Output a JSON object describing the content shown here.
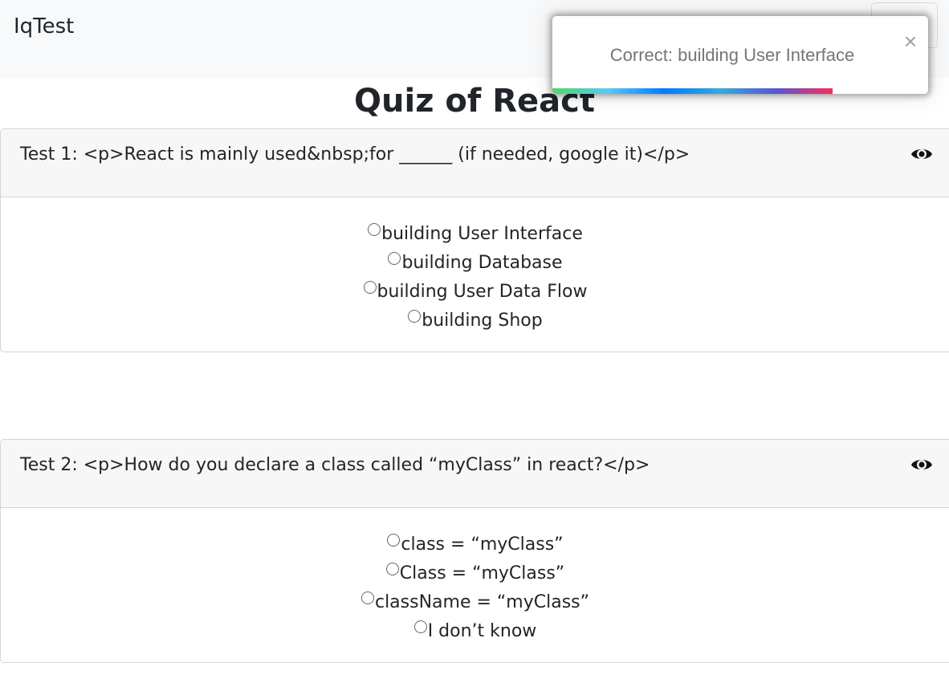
{
  "navbar": {
    "brand": "IqTest",
    "toggler_icon": "hamburger-menu-icon"
  },
  "page": {
    "title": "Quiz of React"
  },
  "tests": [
    {
      "question": "Test 1: <p>React is mainly used&nbsp;for ______ (if needed, google it)</p>",
      "reveal_icon": "eye-icon",
      "options": [
        "building User Interface",
        "building Database",
        "building User Data Flow",
        "building Shop"
      ]
    },
    {
      "question": "Test 2: <p>How do you declare a class called “myClass” in react?</p>",
      "reveal_icon": "eye-icon",
      "options": [
        "class = “myClass”",
        "Class = “myClass”",
        "className = “myClass”",
        "I don’t know"
      ]
    }
  ],
  "toast": {
    "message": "Correct: building User Interface",
    "close_label": "×",
    "progress_fraction": 0.745,
    "progress_colors": [
      "#4cd964",
      "#5ac8fa",
      "#007aff",
      "#34aadc",
      "#5856d6",
      "#ff2d55"
    ]
  }
}
